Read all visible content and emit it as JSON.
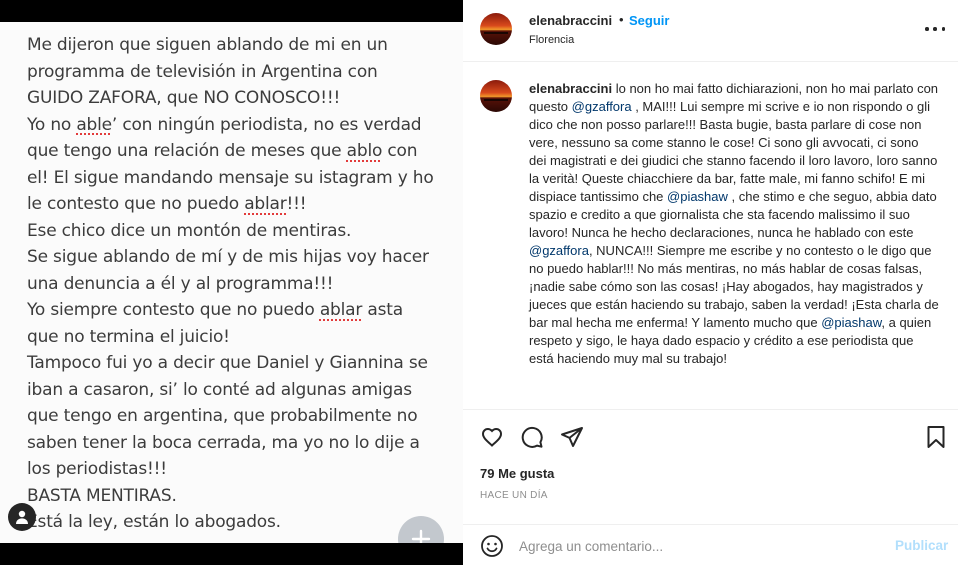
{
  "media": {
    "note_lines": [
      [
        {
          "t": "Me dijeron que siguen ablando de mi en un"
        }
      ],
      [
        {
          "t": "programma de televisión in Argentina con"
        }
      ],
      [
        {
          "t": "GUIDO ZAFORA, que NO CONOSCO!!!"
        }
      ],
      [
        {
          "t": "Yo no "
        },
        {
          "t": "able",
          "sq": true
        },
        {
          "t": "’ con ningún periodista, no es verdad"
        }
      ],
      [
        {
          "t": "que tengo una relación de meses que "
        },
        {
          "t": "ablo",
          "sq": true
        },
        {
          "t": " con"
        }
      ],
      [
        {
          "t": "el! El sigue mandando mensaje su istagram y ho"
        }
      ],
      [
        {
          "t": "le contesto que no puedo "
        },
        {
          "t": "ablar",
          "sq": true
        },
        {
          "t": "!!!"
        }
      ],
      [
        {
          "t": "Ese chico dice un montón de mentiras."
        }
      ],
      [
        {
          "t": "Se sigue ablando de mí y de mis hijas voy hacer"
        }
      ],
      [
        {
          "t": "una denuncia a él y al programma!!!"
        }
      ],
      [
        {
          "t": "Yo siempre contesto que no puedo "
        },
        {
          "t": "ablar",
          "sq": true
        },
        {
          "t": " asta"
        }
      ],
      [
        {
          "t": "que no termina el juicio!"
        }
      ],
      [
        {
          "t": "Tampoco fui yo a decir que Daniel y Giannina se"
        }
      ],
      [
        {
          "t": "iban a casaron, si’ lo conté ad algunas amigas"
        }
      ],
      [
        {
          "t": "que tengo en argentina, que probabilmente no"
        }
      ],
      [
        {
          "t": "saben tener la boca cerrada, ma yo no lo dije a"
        }
      ],
      [
        {
          "t": "los periodistas!!!"
        }
      ],
      [
        {
          "t": "BASTA MENTIRAS."
        }
      ],
      [
        {
          "t": "Está la ley, están lo abogados."
        }
      ]
    ],
    "add_icon": "plus-icon",
    "user_tag_icon": "person-icon"
  },
  "header": {
    "username": "elenabraccini",
    "separator": "•",
    "follow_label": "Seguir",
    "location": "Florencia"
  },
  "caption": {
    "username": "elenabraccini",
    "segments": [
      {
        "t": " lo non ho mai fatto dichiarazioni, non ho mai parlato con questo "
      },
      {
        "t": "@gzaffora",
        "mention": true
      },
      {
        "t": " , MAI!!! Lui sempre mi scrive e io non rispondo o gli dico che non posso parlare!!! Basta bugie, basta parlare di cose non vere, nessuno sa come stanno le cose! Ci sono gli avvocati, ci sono dei magistrati e dei giudici che stanno facendo il loro lavoro, loro sanno la verità! Queste chiacchiere da bar, fatte male, mi fanno schifo! E mi dispiace tantissimo che "
      },
      {
        "t": "@piashaw",
        "mention": true
      },
      {
        "t": " , che stimo e che seguo, abbia dato spazio e credito a que giornalista che sta facendo malissimo il suo lavoro! Nunca he hecho declaraciones, nunca he hablado con este "
      },
      {
        "t": "@gzaffora",
        "mention": true
      },
      {
        "t": ", NUNCA!!! Siempre me escribe y no contesto o le digo que no puedo hablar!!! No más mentiras, no más hablar de cosas falsas, ¡nadie sabe cómo son las cosas! ¡Hay abogados, hay magistrados y jueces que están haciendo su trabajo, saben la verdad! ¡Esta charla de bar mal hecha me enferma! Y lamento mucho que "
      },
      {
        "t": "@piashaw",
        "mention": true
      },
      {
        "t": ", a quien respeto y sigo, le haya dado espacio y crédito a ese periodista que está haciendo muy mal su trabajo!"
      }
    ]
  },
  "actions": {
    "icons": [
      "heart-icon",
      "comment-icon",
      "share-icon",
      "bookmark-icon"
    ]
  },
  "stats": {
    "likes": "79 Me gusta",
    "time": "HACE UN DÍA"
  },
  "comment": {
    "placeholder": "Agrega un comentario...",
    "publish_label": "Publicar",
    "emoji_icon": "emoji-icon"
  },
  "colors": {
    "accent": "#0095f6",
    "publish_disabled": "#b2dffc",
    "mention": "#00376b",
    "text": "#262626",
    "muted": "#8e8e8e"
  }
}
